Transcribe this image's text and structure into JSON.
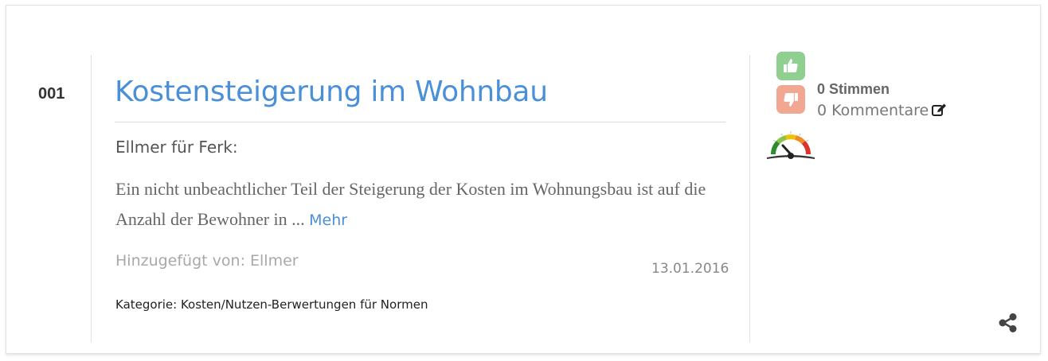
{
  "entry": {
    "number": "001",
    "title": "Kostensteigerung im Wohnbau",
    "subheading": "Ellmer für Ferk:",
    "excerpt": "Ein nicht unbeachtlicher Teil der Steigerung der Kosten im Wohnungsbau ist auf die Anzahl der Bewohner in ...",
    "more_label": "Mehr",
    "author": "Hinzugefügt von: Ellmer",
    "date": "13.01.2016",
    "category": "Kategorie: Kosten/Nutzen-Berwertungen für Normen"
  },
  "sidebar": {
    "votes": "0 Stimmen",
    "comments": "0 Kommentare",
    "icons": [
      "thumbs-up-icon",
      "thumbs-down-icon",
      "edit-icon",
      "rating-gauge-icon",
      "share-icon"
    ],
    "colors": {
      "up": "#8fcf8f",
      "down": "#f1a792",
      "link": "#4a90d9"
    }
  }
}
